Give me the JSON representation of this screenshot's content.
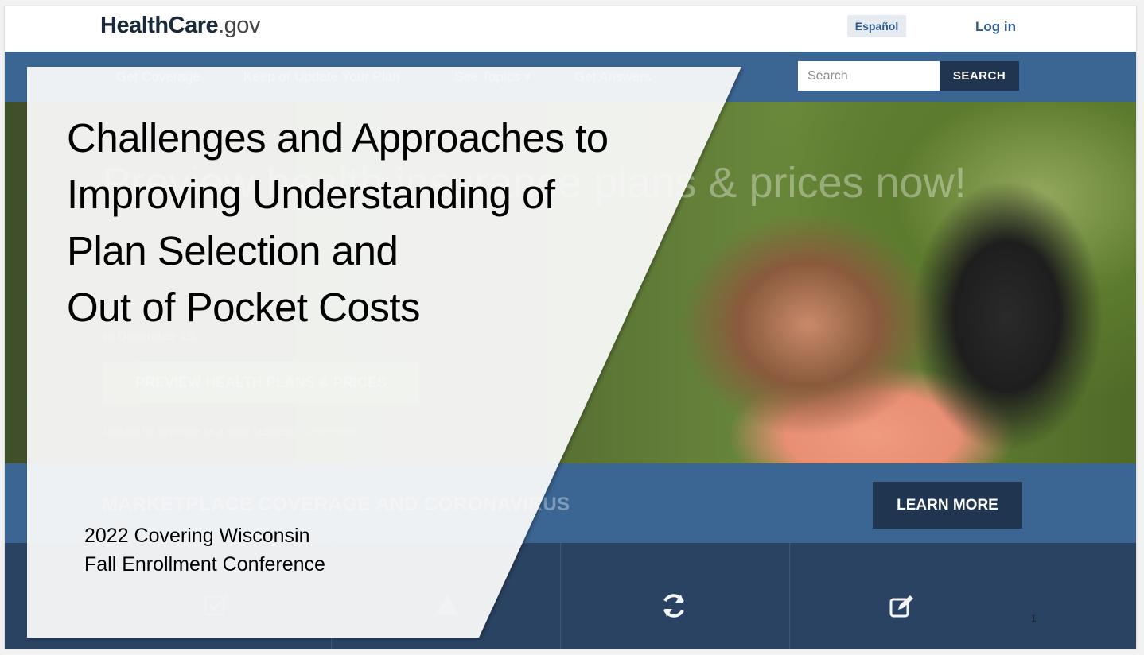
{
  "header": {
    "logo_main": "HealthCare",
    "logo_suffix": ".gov",
    "espanol_label": "Español",
    "login_label": "Log in"
  },
  "nav": {
    "items": [
      "Get Coverage",
      "Keep or Update Your Plan",
      "See Topics ▾",
      "Get Answers"
    ],
    "search_placeholder": "Search",
    "search_button": "SEARCH"
  },
  "hero": {
    "heading": "Preview health insurance plans & prices now!",
    "subtext": "to December 15.",
    "cta_label": "PREVIEW HEALTH PLANS & PRICES",
    "small_text": "Looking for coverage for a small business? Learn more"
  },
  "band": {
    "text": "MARKETPLACE COVERAGE AND CORONAVIRUS",
    "learn_more": "LEARN MORE"
  },
  "tiles": {
    "icons": [
      "checkbox-icon",
      "apply-icon",
      "refresh-icon",
      "edit-icon"
    ]
  },
  "slide": {
    "title_lines": [
      "Challenges and Approaches to",
      "Improving Understanding of",
      "Plan Selection and",
      "Out of Pocket Costs"
    ],
    "subtitle_lines": [
      "2022 Covering Wisconsin",
      "Fall Enrollment Conference"
    ],
    "slide_number": "1"
  }
}
